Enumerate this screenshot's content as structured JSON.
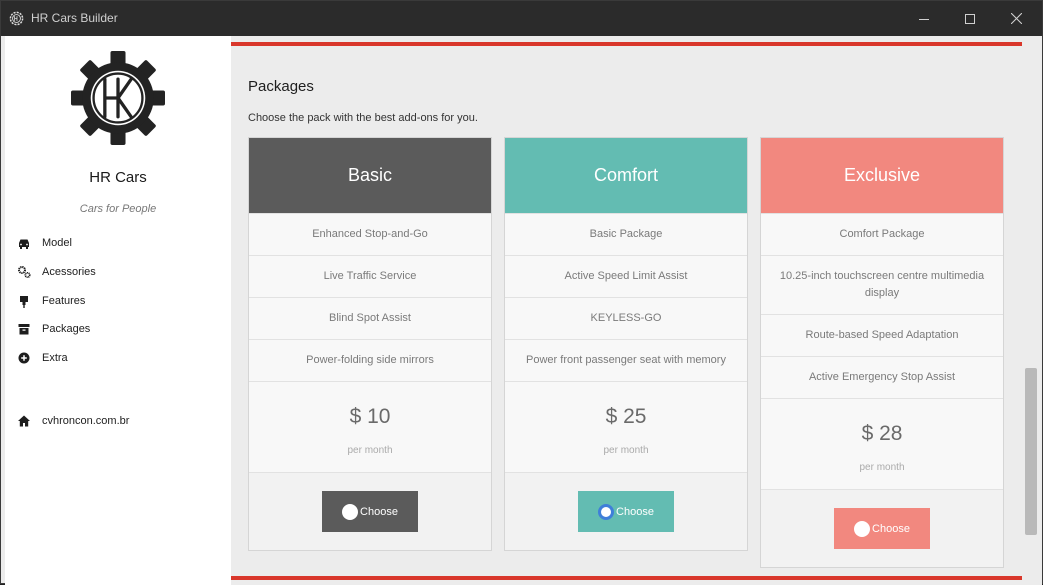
{
  "window": {
    "title": "HR Cars Builder",
    "minimize_icon": "minimize-icon",
    "maximize_icon": "maximize-icon",
    "close_icon": "close-icon"
  },
  "sidebar": {
    "brand_name": "HR Cars",
    "tagline": "Cars for People",
    "items": [
      {
        "label": "Model",
        "icon": "car-icon"
      },
      {
        "label": "Acessories",
        "icon": "gears-icon"
      },
      {
        "label": "Features",
        "icon": "plug-icon"
      },
      {
        "label": "Packages",
        "icon": "archive-icon"
      },
      {
        "label": "Extra",
        "icon": "plus-circle-icon"
      }
    ],
    "site": {
      "label": "cvhroncon.com.br",
      "icon": "home-icon"
    }
  },
  "main": {
    "title": "Packages",
    "subtitle": "Choose the pack with the best add-ons for you.",
    "packages": [
      {
        "name": "Basic",
        "color": "#5b5b5b",
        "features": [
          "Enhanced Stop-and-Go",
          "Live Traffic Service",
          "Blind Spot Assist",
          "Power-folding side mirrors"
        ],
        "price": "$ 10",
        "period": "per month",
        "button": "Choose",
        "selected": false
      },
      {
        "name": "Comfort",
        "color": "#63bcb2",
        "features": [
          "Basic Package",
          "Active Speed Limit Assist",
          "KEYLESS-GO",
          "Power front passenger seat with memory"
        ],
        "price": "$ 25",
        "period": "per month",
        "button": "Choose",
        "selected": true
      },
      {
        "name": "Exclusive",
        "color": "#f2887f",
        "features": [
          "Comfort Package",
          "10.25-inch touchscreen centre multimedia display",
          "Route-based Speed Adaptation",
          "Active Emergency Stop Assist"
        ],
        "price": "$ 28",
        "period": "per month",
        "button": "Choose",
        "selected": false
      }
    ]
  },
  "colors": {
    "accent_line": "#d9372b",
    "radio_selected": "#3f7fd9"
  }
}
